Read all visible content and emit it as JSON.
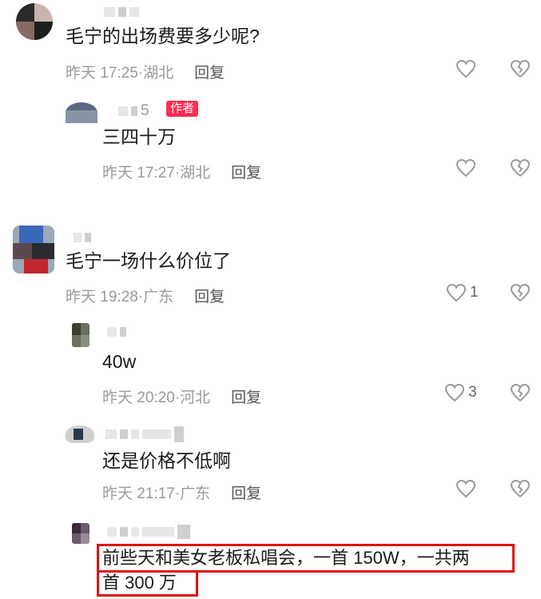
{
  "comments": [
    {
      "text": "毛宁的出场费要多少呢?",
      "time": "昨天 17:25",
      "location": "湖北",
      "reply": "回复",
      "likes": ""
    },
    {
      "name_suffix": "5",
      "badge": "作者",
      "text": "三四十万",
      "time": "昨天 17:27",
      "location": "湖北",
      "reply": "回复",
      "likes": ""
    },
    {
      "text": "毛宁一场什么价位了",
      "time": "昨天 19:28",
      "location": "广东",
      "reply": "回复",
      "likes": "1"
    },
    {
      "text": "40w",
      "time": "昨天 20:20",
      "location": "河北",
      "reply": "回复",
      "likes": "3"
    },
    {
      "text": "还是价格不低啊",
      "time": "昨天 21:17",
      "location": "广东",
      "reply": "回复",
      "likes": ""
    },
    {
      "text_line1": "前些天和美女老板私唱会，一首 150W，一共两",
      "text_line2": "首 300 万"
    }
  ],
  "icons": {
    "like": "heart-outline-icon",
    "dislike": "broken-heart-icon"
  },
  "colors": {
    "author_badge": "#fe2c55",
    "highlight": "#e01010",
    "meta": "#9a9a9a"
  }
}
